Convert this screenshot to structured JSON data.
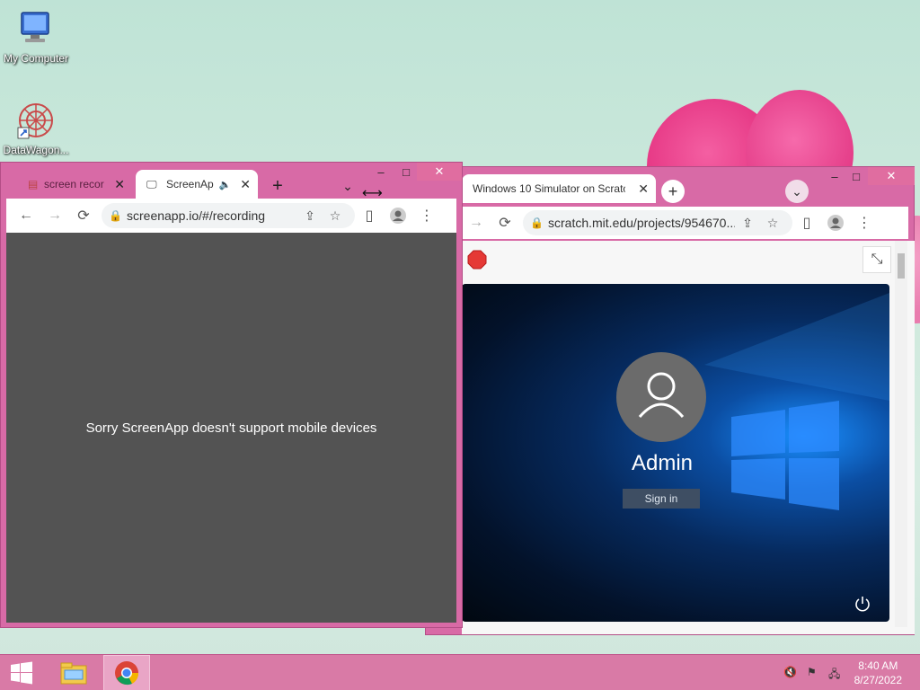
{
  "desktop": {
    "icons": [
      {
        "label": "My Computer",
        "icon": "computer-icon"
      },
      {
        "label": "DataWagon...",
        "icon": "datawagon-icon"
      }
    ]
  },
  "left_window": {
    "tabs": [
      {
        "label": "screen recor",
        "icon": "favicon-icon",
        "close": "✕"
      },
      {
        "label": "ScreenAp",
        "icon": "screen-icon",
        "audio": "🔈",
        "close": "✕"
      }
    ],
    "new_tab": "+",
    "tab_list": "⌄",
    "controls": {
      "minimize": "–",
      "maximize": "□",
      "close": "✕"
    },
    "url": "screenapp.io/#/recording",
    "message": "Sorry ScreenApp doesn't support mobile devices",
    "content_bg": "#535353"
  },
  "right_window": {
    "tab": {
      "label": "Windows 10 Simulator on Scratc",
      "close": "✕"
    },
    "new_tab": "+",
    "tab_list": "⌄",
    "controls": {
      "minimize": "–",
      "maximize": "□",
      "close": "✕"
    },
    "url": "scratch.mit.edu/projects/954670...",
    "stage": {
      "user_name": "Admin",
      "sign_in_label": "Sign in"
    }
  },
  "taskbar": {
    "start_icon": "windows-logo-icon",
    "pinned": [
      {
        "name": "file-explorer-icon"
      },
      {
        "name": "chrome-icon"
      }
    ],
    "time": "8:40 AM",
    "date": "8/27/2022"
  },
  "colors": {
    "window_frame": "#d86aa6",
    "taskbar": "#d97aa6",
    "stop_button": "#e53935"
  }
}
